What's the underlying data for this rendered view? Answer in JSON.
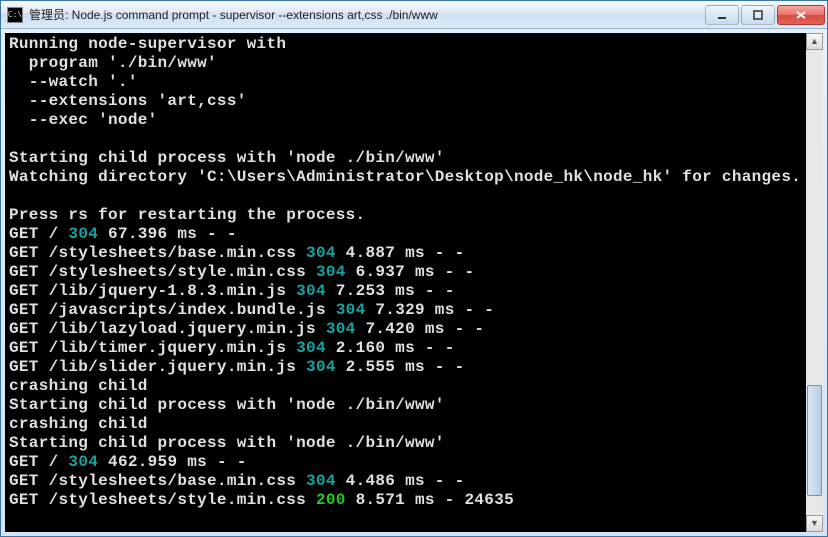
{
  "titlebar": {
    "icon_label": "C:\\",
    "title": "管理员: Node.js command prompt - supervisor  --extensions art,css ./bin/www"
  },
  "terminal": {
    "lines": [
      {
        "segs": [
          {
            "t": "Running node-supervisor with"
          }
        ]
      },
      {
        "segs": [
          {
            "t": "  program './bin/www'"
          }
        ]
      },
      {
        "segs": [
          {
            "t": "  --watch '.'"
          }
        ]
      },
      {
        "segs": [
          {
            "t": "  --extensions 'art,css'"
          }
        ]
      },
      {
        "segs": [
          {
            "t": "  --exec 'node'"
          }
        ]
      },
      {
        "segs": [
          {
            "t": ""
          }
        ]
      },
      {
        "segs": [
          {
            "t": "Starting child process with 'node ./bin/www'"
          }
        ]
      },
      {
        "segs": [
          {
            "t": "Watching directory 'C:\\Users\\Administrator\\Desktop\\node_hk\\node_hk' for changes."
          }
        ]
      },
      {
        "segs": [
          {
            "t": ""
          }
        ]
      },
      {
        "segs": [
          {
            "t": "Press rs for restarting the process."
          }
        ]
      },
      {
        "segs": [
          {
            "t": "GET / "
          },
          {
            "t": "304",
            "c": "c-304"
          },
          {
            "t": " 67.396 ms - -"
          }
        ]
      },
      {
        "segs": [
          {
            "t": "GET /stylesheets/base.min.css "
          },
          {
            "t": "304",
            "c": "c-304"
          },
          {
            "t": " 4.887 ms - -"
          }
        ]
      },
      {
        "segs": [
          {
            "t": "GET /stylesheets/style.min.css "
          },
          {
            "t": "304",
            "c": "c-304"
          },
          {
            "t": " 6.937 ms - -"
          }
        ]
      },
      {
        "segs": [
          {
            "t": "GET /lib/jquery-1.8.3.min.js "
          },
          {
            "t": "304",
            "c": "c-304"
          },
          {
            "t": " 7.253 ms - -"
          }
        ]
      },
      {
        "segs": [
          {
            "t": "GET /javascripts/index.bundle.js "
          },
          {
            "t": "304",
            "c": "c-304"
          },
          {
            "t": " 7.329 ms - -"
          }
        ]
      },
      {
        "segs": [
          {
            "t": "GET /lib/lazyload.jquery.min.js "
          },
          {
            "t": "304",
            "c": "c-304"
          },
          {
            "t": " 7.420 ms - -"
          }
        ]
      },
      {
        "segs": [
          {
            "t": "GET /lib/timer.jquery.min.js "
          },
          {
            "t": "304",
            "c": "c-304"
          },
          {
            "t": " 2.160 ms - -"
          }
        ]
      },
      {
        "segs": [
          {
            "t": "GET /lib/slider.jquery.min.js "
          },
          {
            "t": "304",
            "c": "c-304"
          },
          {
            "t": " 2.555 ms - -"
          }
        ]
      },
      {
        "segs": [
          {
            "t": "crashing child"
          }
        ]
      },
      {
        "segs": [
          {
            "t": "Starting child process with 'node ./bin/www'"
          }
        ]
      },
      {
        "segs": [
          {
            "t": "crashing child"
          }
        ]
      },
      {
        "segs": [
          {
            "t": "Starting child process with 'node ./bin/www'"
          }
        ]
      },
      {
        "segs": [
          {
            "t": "GET / "
          },
          {
            "t": "304",
            "c": "c-304"
          },
          {
            "t": " 462.959 ms - -"
          }
        ]
      },
      {
        "segs": [
          {
            "t": "GET /stylesheets/base.min.css "
          },
          {
            "t": "304",
            "c": "c-304"
          },
          {
            "t": " 4.486 ms - -"
          }
        ]
      },
      {
        "segs": [
          {
            "t": "GET /stylesheets/style.min.css "
          },
          {
            "t": "200",
            "c": "c-200"
          },
          {
            "t": " 8.571 ms - 24635"
          }
        ]
      }
    ]
  }
}
